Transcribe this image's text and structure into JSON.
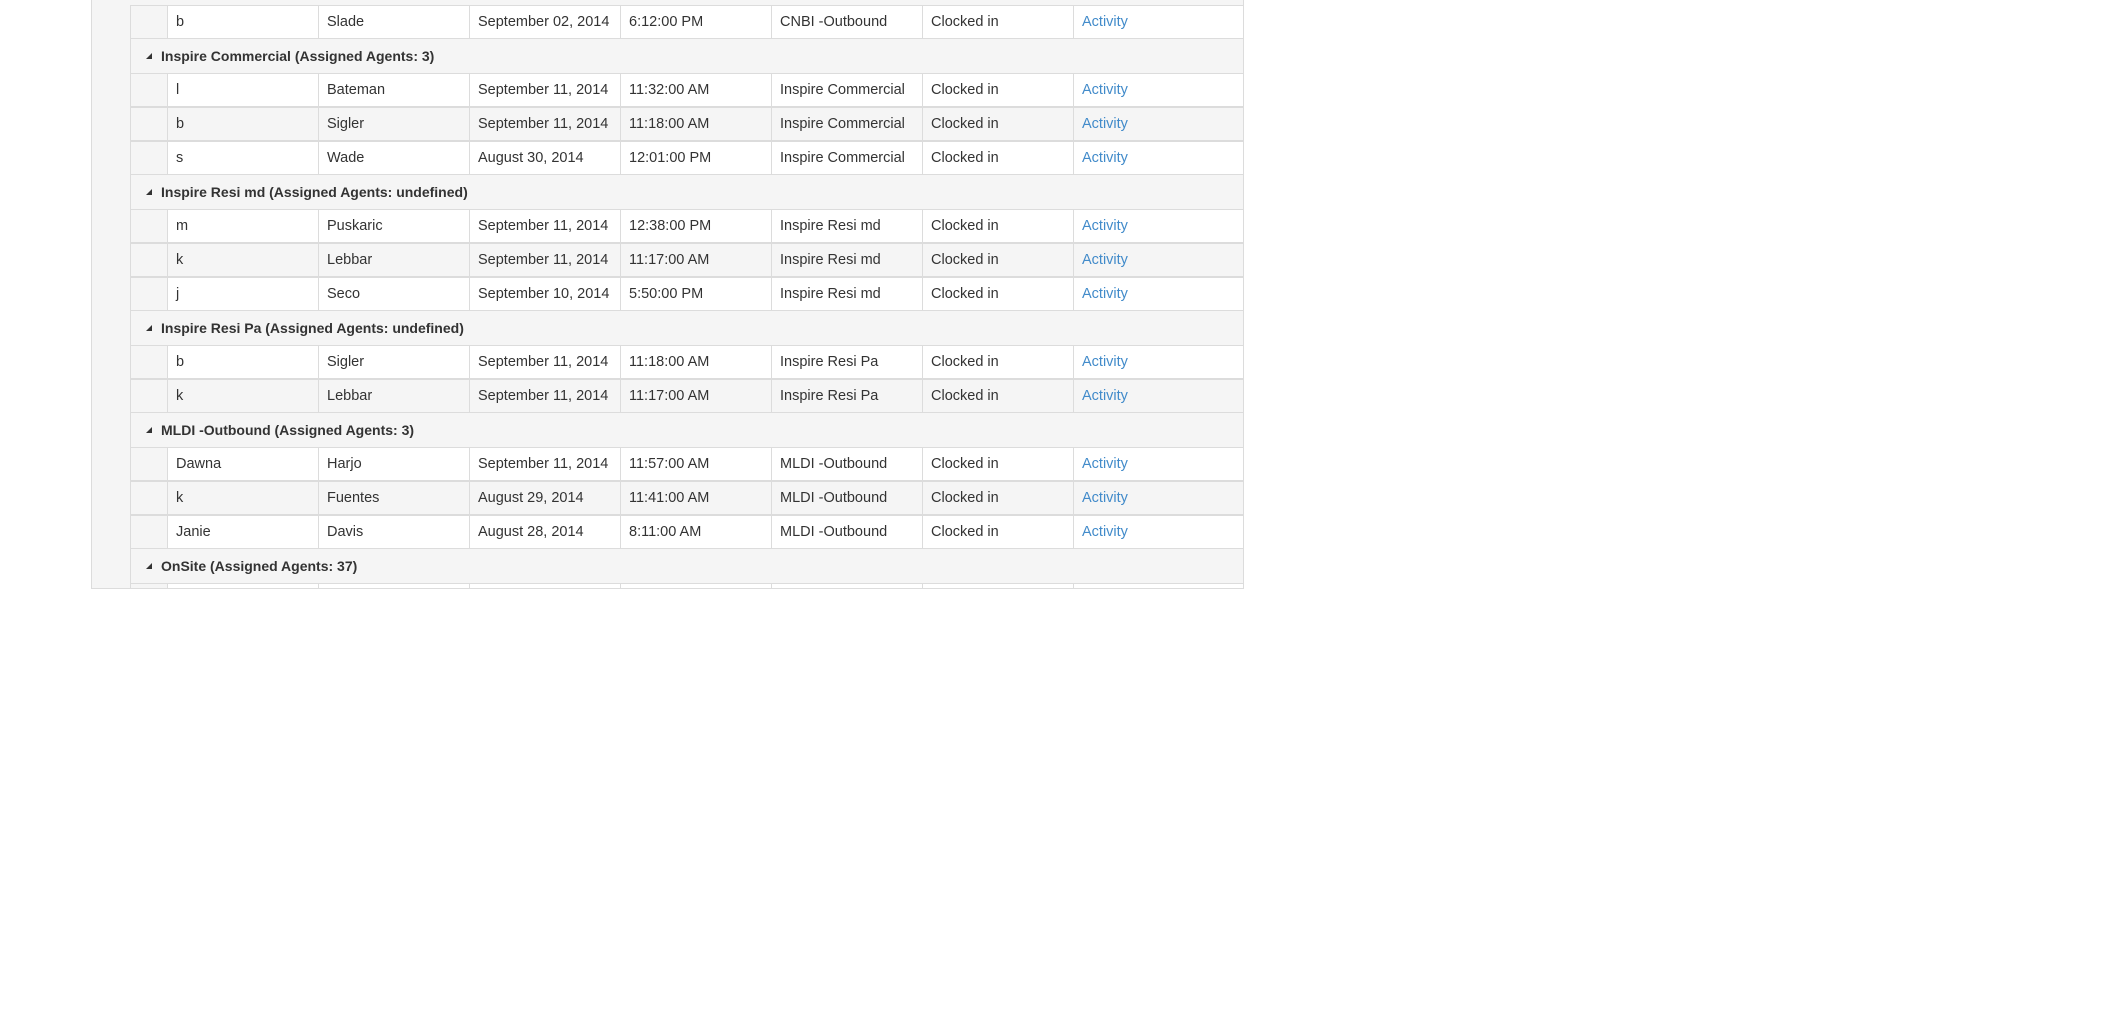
{
  "groups": [
    {
      "header": "",
      "rows": [
        {
          "first": "b",
          "last": "Slade",
          "date": "September 02, 2014",
          "time": "6:12:00 PM",
          "campaign": "CNBI -Outbound",
          "status": "Clocked in",
          "action": "Activity"
        }
      ]
    },
    {
      "header": "Inspire Commercial (Assigned Agents: 3)",
      "rows": [
        {
          "first": "l",
          "last": "Bateman",
          "date": "September 11, 2014",
          "time": "11:32:00 AM",
          "campaign": "Inspire Commercial",
          "status": "Clocked in",
          "action": "Activity"
        },
        {
          "first": "b",
          "last": "Sigler",
          "date": "September 11, 2014",
          "time": "11:18:00 AM",
          "campaign": "Inspire Commercial",
          "status": "Clocked in",
          "action": "Activity"
        },
        {
          "first": "s",
          "last": "Wade",
          "date": "August 30, 2014",
          "time": "12:01:00 PM",
          "campaign": "Inspire Commercial",
          "status": "Clocked in",
          "action": "Activity"
        }
      ]
    },
    {
      "header": "Inspire Resi md (Assigned Agents: undefined)",
      "rows": [
        {
          "first": "m",
          "last": "Puskaric",
          "date": "September 11, 2014",
          "time": "12:38:00 PM",
          "campaign": "Inspire Resi md",
          "status": "Clocked in",
          "action": "Activity"
        },
        {
          "first": "k",
          "last": "Lebbar",
          "date": "September 11, 2014",
          "time": "11:17:00 AM",
          "campaign": "Inspire Resi md",
          "status": "Clocked in",
          "action": "Activity"
        },
        {
          "first": "j",
          "last": "Seco",
          "date": "September 10, 2014",
          "time": "5:50:00 PM",
          "campaign": "Inspire Resi md",
          "status": "Clocked in",
          "action": "Activity"
        }
      ]
    },
    {
      "header": "Inspire Resi Pa (Assigned Agents: undefined)",
      "rows": [
        {
          "first": "b",
          "last": "Sigler",
          "date": "September 11, 2014",
          "time": "11:18:00 AM",
          "campaign": "Inspire Resi Pa",
          "status": "Clocked in",
          "action": "Activity"
        },
        {
          "first": "k",
          "last": "Lebbar",
          "date": "September 11, 2014",
          "time": "11:17:00 AM",
          "campaign": "Inspire Resi Pa",
          "status": "Clocked in",
          "action": "Activity"
        }
      ]
    },
    {
      "header": "MLDI -Outbound (Assigned Agents: 3)",
      "rows": [
        {
          "first": "Dawna",
          "last": "Harjo",
          "date": "September 11, 2014",
          "time": "11:57:00 AM",
          "campaign": "MLDI -Outbound",
          "status": "Clocked in",
          "action": "Activity"
        },
        {
          "first": "k",
          "last": "Fuentes",
          "date": "August 29, 2014",
          "time": "11:41:00 AM",
          "campaign": "MLDI -Outbound",
          "status": "Clocked in",
          "action": "Activity"
        },
        {
          "first": "Janie",
          "last": "Davis",
          "date": "August 28, 2014",
          "time": "8:11:00 AM",
          "campaign": "MLDI -Outbound",
          "status": "Clocked in",
          "action": "Activity"
        }
      ]
    },
    {
      "header": "OnSite (Assigned Agents: 37)",
      "rows": [
        {
          "first": "",
          "last": "",
          "date": "",
          "time": "",
          "campaign": "",
          "status": "",
          "action": ""
        }
      ]
    }
  ]
}
